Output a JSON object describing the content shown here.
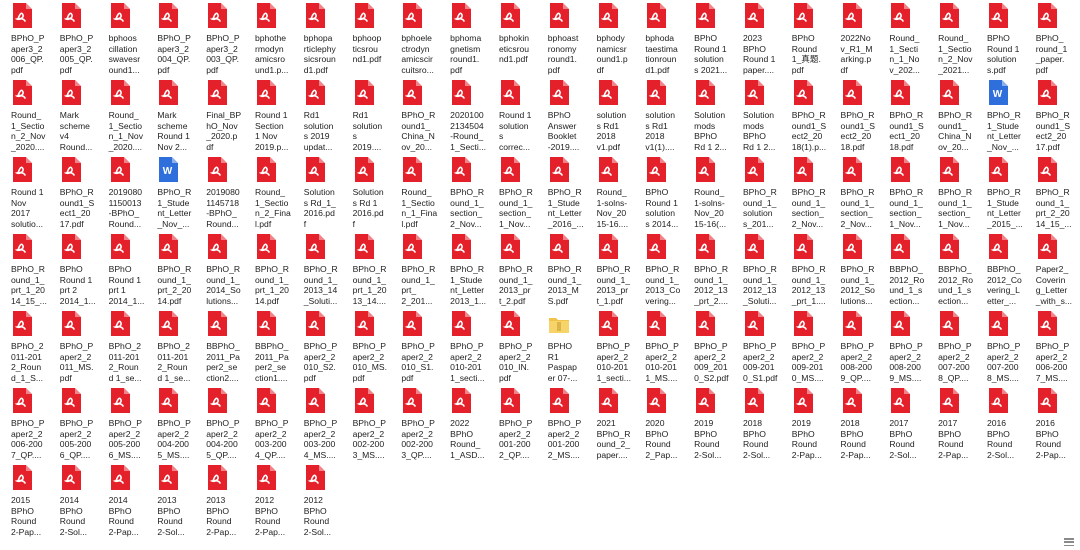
{
  "colors": {
    "pdf": "#e4202a",
    "word": "#2f6fdc",
    "folder": "#f2c34a"
  },
  "files": [
    {
      "name": "BPhO_P\naper3_2\n006_QP.\npdf",
      "type": "pdf"
    },
    {
      "name": "BPhO_P\naper3_2\n005_QP.\npdf",
      "type": "pdf"
    },
    {
      "name": "bphoos\ncillation\nswavesr\nound1...",
      "type": "pdf"
    },
    {
      "name": "BPhO_P\naper3_2\n004_QP.\npdf",
      "type": "pdf"
    },
    {
      "name": "BPhO_P\naper3_2\n003_QP.\npdf",
      "type": "pdf"
    },
    {
      "name": "bphothe\nrmodyn\namicsro\nund1.p...",
      "type": "pdf"
    },
    {
      "name": "bphopa\nrticlephy\nsicsroun\nd1.pdf",
      "type": "pdf"
    },
    {
      "name": "bphoop\nticsrou\nnd1.pdf",
      "type": "pdf"
    },
    {
      "name": "bphoele\nctrodyn\namicscir\ncuitsro...",
      "type": "pdf"
    },
    {
      "name": "bphoma\ngnetism\nround1.\npdf",
      "type": "pdf"
    },
    {
      "name": "bphokin\neticsrou\nnd1.pdf",
      "type": "pdf"
    },
    {
      "name": "bphoast\nronomy\nround1.\npdf",
      "type": "pdf"
    },
    {
      "name": "bphody\nnamicsr\nound1.p\ndf",
      "type": "pdf"
    },
    {
      "name": "bphoda\ntaestima\ntionroun\nd1.pdf",
      "type": "pdf"
    },
    {
      "name": "BPhO\nRound 1\nsolution\ns 2021...",
      "type": "pdf"
    },
    {
      "name": "2023\nBPhO\nRound 1\npaper....",
      "type": "pdf"
    },
    {
      "name": "BPhO\nRound\n1_真题.\npdf",
      "type": "pdf"
    },
    {
      "name": "2022No\nv_R1_M\narking.p\ndf",
      "type": "pdf"
    },
    {
      "name": "Round_\n1_Secti\nn_1_No\nv_202...",
      "type": "pdf"
    },
    {
      "name": "Round_\n1_Sectio\nn_2_Nov\n_2021...",
      "type": "pdf"
    },
    {
      "name": "BPhO\nRound 1\nsolution\ns.pdf",
      "type": "pdf"
    },
    {
      "name": "BPhO_\nround_1\n_paper.\npdf",
      "type": "pdf"
    },
    {
      "name": "Round_\n1_Sectio\nn_2_Nov\n_2020....",
      "type": "pdf"
    },
    {
      "name": "Mark\nscheme\nv4\nRound...",
      "type": "pdf"
    },
    {
      "name": "Round_\n1_Sectio\nn_1_Nov\n_2020....",
      "type": "pdf"
    },
    {
      "name": "Mark\nscheme\nRound 1\nNov 2...",
      "type": "pdf"
    },
    {
      "name": "Final_BP\nhO_Nov\n_2020.p\ndf",
      "type": "pdf"
    },
    {
      "name": "Round 1\nSection\n1 Nov\n2019.p...",
      "type": "pdf"
    },
    {
      "name": "Rd1\nsolution\ns 2019\nupdat...",
      "type": "pdf"
    },
    {
      "name": "Rd1\nsolution\ns\n2019....",
      "type": "pdf"
    },
    {
      "name": "BPhO_R\nound1_\nChina_N\nov_20...",
      "type": "pdf"
    },
    {
      "name": "2020100\n2134504\n-Round_\n1_Secti...",
      "type": "pdf"
    },
    {
      "name": "Round 1\nsolution\ns\ncorrec...",
      "type": "pdf"
    },
    {
      "name": "BPhO\nAnswer\nBooklet\n-2019....",
      "type": "pdf"
    },
    {
      "name": "solution\ns Rd1\n2018\nv1.pdf",
      "type": "pdf"
    },
    {
      "name": "solution\ns Rd1\n2018\nv1(1)....",
      "type": "pdf"
    },
    {
      "name": "Solution\nmods\nBPhO\nRd 1 2...",
      "type": "pdf"
    },
    {
      "name": "Solution\nmods\nBPhO\nRd 1 2...",
      "type": "pdf"
    },
    {
      "name": "BPhO_R\nound1_S\nect2_20\n18(1).p...",
      "type": "pdf"
    },
    {
      "name": "BPhO_R\nound1_S\nect2_20\n18.pdf",
      "type": "pdf"
    },
    {
      "name": "BPhO_R\nound1_S\nect1_20\n18.pdf",
      "type": "pdf"
    },
    {
      "name": "BPhO_R\nound1_\nChina_N\nov_20...",
      "type": "pdf"
    },
    {
      "name": "BPhO_R\n1_Stude\nnt_Letter\n_Nov_...",
      "type": "word"
    },
    {
      "name": "BPhO_R\nound1_S\nect2_20\n17.pdf",
      "type": "pdf"
    },
    {
      "name": "Round 1\nNov\n2017\nsolutio...",
      "type": "pdf"
    },
    {
      "name": "BPhO_R\nound1_S\nect1_20\n17.pdf",
      "type": "pdf"
    },
    {
      "name": "2019080\n1150013\n-BPhO_\nRound...",
      "type": "pdf"
    },
    {
      "name": "BPhO_R\n1_Stude\nnt_Letter\n_Nov_...",
      "type": "word"
    },
    {
      "name": "2019080\n1145718\n-BPhO_\nRound...",
      "type": "pdf"
    },
    {
      "name": "Round_\n1_Sectio\nn_2_Fina\nl.pdf",
      "type": "pdf"
    },
    {
      "name": "Solution\ns Rd_1_\n2016.pd\nf",
      "type": "pdf"
    },
    {
      "name": "Solution\ns Rd 1\n2016.pd\nf",
      "type": "pdf"
    },
    {
      "name": "Round_\n1_Sectio\nn_1_Fina\nl.pdf",
      "type": "pdf"
    },
    {
      "name": "BPhO_R\nound_1_\nsection_\n2_Nov...",
      "type": "pdf"
    },
    {
      "name": "BPhO_R\nound_1_\nsection_\n1_Nov...",
      "type": "pdf"
    },
    {
      "name": "BPhO_R\n1_Stude\nnt_Letter\n_2016_...",
      "type": "pdf"
    },
    {
      "name": "Round_\n1-solns-\nNov_20\n15-16....",
      "type": "pdf"
    },
    {
      "name": "BPhO\nRound 1\nsolution\ns 2014...",
      "type": "pdf"
    },
    {
      "name": "Round_\n1-solns-\nNov_20\n15-16(...",
      "type": "pdf"
    },
    {
      "name": "BPhO_R\nound_1_\nsolution\ns_201...",
      "type": "pdf"
    },
    {
      "name": "BPhO_R\nound_1_\nsection_\n2_Nov...",
      "type": "pdf"
    },
    {
      "name": "BPhO_R\nound_1_\nsection_\n2_Nov...",
      "type": "pdf"
    },
    {
      "name": "BPhO_R\nound_1_\nsection_\n1_Nov...",
      "type": "pdf"
    },
    {
      "name": "BPhO_R\nound_1_\nsection_\n1_Nov...",
      "type": "pdf"
    },
    {
      "name": "BPhO_R\n1_Stude\nnt_Letter\n_2015_...",
      "type": "pdf"
    },
    {
      "name": "BPhO_R\nound_1_\nprt_2_20\n14_15_...",
      "type": "pdf"
    },
    {
      "name": "BPhO_R\nound_1_\nprt_1_20\n14_15_...",
      "type": "pdf"
    },
    {
      "name": "BPhO\nRound 1\nprt 2\n2014_1...",
      "type": "pdf"
    },
    {
      "name": "BPhO\nRound 1\nprt 1\n2014_1...",
      "type": "pdf"
    },
    {
      "name": "BPhO_R\nound_1_\nprt_2_20\n14.pdf",
      "type": "pdf"
    },
    {
      "name": "BPhO_R\nound_1_\n2014_So\nlutions...",
      "type": "pdf"
    },
    {
      "name": "BPhO_R\nound_1_\nprt_1_20\n14.pdf",
      "type": "pdf"
    },
    {
      "name": "BPhO_R\nound_1_\n2013_14\n_Soluti...",
      "type": "pdf"
    },
    {
      "name": "BPhO_R\nound_1_\nprt_1_20\n13_14....",
      "type": "pdf"
    },
    {
      "name": "BPhO_R\nound_1_\nprt_\n2_201...",
      "type": "pdf"
    },
    {
      "name": "BPhO_R\n1_Stude\nnt_Letter\n2013_1...",
      "type": "pdf"
    },
    {
      "name": "BPhO_R\nound_1_\n2013_pr\nt_2.pdf",
      "type": "pdf"
    },
    {
      "name": "BPhO_R\nound_1_\n2013_M\nS.pdf",
      "type": "pdf"
    },
    {
      "name": "BPhO_R\nound_1_\n2013_pr\nt_1.pdf",
      "type": "pdf"
    },
    {
      "name": "BPhO_R\nound_1_\n2013_Co\nvering...",
      "type": "pdf"
    },
    {
      "name": "BPhO_R\nound_1_\n2012_13\n_prt_2....",
      "type": "pdf"
    },
    {
      "name": "BPhO_R\nound_1_\n2012_13\n_Soluti...",
      "type": "pdf"
    },
    {
      "name": "BPhO_R\nound_1_\n2012_13\n_prt_1....",
      "type": "pdf"
    },
    {
      "name": "BPhO_R\nound_1_\n2012_So\nlutions...",
      "type": "pdf"
    },
    {
      "name": "BBPhO_\n2012_Ro\nund_1_s\nection...",
      "type": "pdf"
    },
    {
      "name": "BBPhO_\n2012_Ro\nund_1_s\nection...",
      "type": "pdf"
    },
    {
      "name": "BBPhO_\n2012_Co\nvering_L\netter_...",
      "type": "pdf"
    },
    {
      "name": "Paper2_\nCoverin\ng_Letter\n_with_s...",
      "type": "pdf"
    },
    {
      "name": "BPhO_2\n011-201\n2_Roun\nd_1_S...",
      "type": "pdf"
    },
    {
      "name": "BPhO_P\naper2_2\n011_MS.\npdf",
      "type": "pdf"
    },
    {
      "name": "BPhO_2\n011-201\n2_Roun\nd 1_se...",
      "type": "pdf"
    },
    {
      "name": "BPhO_2\n011-201\n2_Roun\nd 1_se...",
      "type": "pdf"
    },
    {
      "name": "BBPhO_\n2011_Pa\nper2_se\nction2....",
      "type": "pdf"
    },
    {
      "name": "BBPhO_\n2011_Pa\nper2_se\nction1....",
      "type": "pdf"
    },
    {
      "name": "BPhO_P\naper2_2\n010_S2.\npdf",
      "type": "pdf"
    },
    {
      "name": "BPhO_P\naper2_2\n010_MS.\npdf",
      "type": "pdf"
    },
    {
      "name": "BPhO_P\naper2_2\n010_S1.\npdf",
      "type": "pdf"
    },
    {
      "name": "BPhO_P\naper2_2\n010-201\n1_secti...",
      "type": "pdf"
    },
    {
      "name": "BPhO_P\naper2_2\n010_IN.\npdf",
      "type": "pdf"
    },
    {
      "name": "BPHO\nR1\nPaspap\ner 07-...",
      "type": "folder"
    },
    {
      "name": "BPhO_P\naper2_2\n010-201\n1_secti...",
      "type": "pdf"
    },
    {
      "name": "BPhO_P\naper2_2\n010-201\n1_MS....",
      "type": "pdf"
    },
    {
      "name": "BPhO_P\naper2_2\n009_201\n0_S2.pdf",
      "type": "pdf"
    },
    {
      "name": "BPhO_P\naper2_2\n009-201\n0_S1.pdf",
      "type": "pdf"
    },
    {
      "name": "BPhO_P\naper2_2\n009-201\n0_MS....",
      "type": "pdf"
    },
    {
      "name": "BPhO_P\naper2_2\n008-200\n9_QP....",
      "type": "pdf"
    },
    {
      "name": "BPhO_P\naper2_2\n008-200\n9_MS....",
      "type": "pdf"
    },
    {
      "name": "BPhO_P\naper2_2\n007-200\n8_QP....",
      "type": "pdf"
    },
    {
      "name": "BPhO_P\naper2_2\n007-200\n8_MS....",
      "type": "pdf"
    },
    {
      "name": "BPhO_P\naper2_2\n006-200\n7_MS....",
      "type": "pdf"
    },
    {
      "name": "BPhO_P\naper2_2\n006-200\n7_QP....",
      "type": "pdf"
    },
    {
      "name": "BPhO_P\naper2_2\n005-200\n6_QP....",
      "type": "pdf"
    },
    {
      "name": "BPhO_P\naper2_2\n005-200\n6_MS....",
      "type": "pdf"
    },
    {
      "name": "BPhO_P\naper2_2\n004-200\n5_MS....",
      "type": "pdf"
    },
    {
      "name": "BPhO_P\naper2_2\n004-200\n5_QP....",
      "type": "pdf"
    },
    {
      "name": "BPhO_P\naper2_2\n003-200\n4_QP....",
      "type": "pdf"
    },
    {
      "name": "BPhO_P\naper2_2\n003-200\n4_MS....",
      "type": "pdf"
    },
    {
      "name": "BPhO_P\naper2_2\n002-200\n3_MS....",
      "type": "pdf"
    },
    {
      "name": "BPhO_P\naper2_2\n002-200\n3_QP....",
      "type": "pdf"
    },
    {
      "name": "2022\nBPhO\nRound_\n1_ASD...",
      "type": "pdf"
    },
    {
      "name": "BPhO_P\naper2_2\n001-200\n2_QP....",
      "type": "pdf"
    },
    {
      "name": "BPhO_P\naper2_2\n001-200\n2_MS....",
      "type": "pdf"
    },
    {
      "name": "2021\nBPhO_R\nound_2_\npaper....",
      "type": "pdf"
    },
    {
      "name": "2020\nBPhO\nRound\n2_Pap...",
      "type": "pdf"
    },
    {
      "name": "2019\nBPhO\nRound\n2-Sol...",
      "type": "pdf"
    },
    {
      "name": "2018\nBPhO\nRound\n2-Sol...",
      "type": "pdf"
    },
    {
      "name": "2019\nBPhO\nRound\n2-Pap...",
      "type": "pdf"
    },
    {
      "name": "2018\nBPhO\nRound\n2-Pap...",
      "type": "pdf"
    },
    {
      "name": "2017\nBPhO\nRound\n2-Sol...",
      "type": "pdf"
    },
    {
      "name": "2017\nBPhO\nRound\n2-Pap...",
      "type": "pdf"
    },
    {
      "name": "2016\nBPhO\nRound\n2-Sol...",
      "type": "pdf"
    },
    {
      "name": "2016\nBPhO\nRound\n2-Pap...",
      "type": "pdf"
    },
    {
      "name": "2015\nBPhO\nRound\n2-Pap...",
      "type": "pdf"
    },
    {
      "name": "2014\nBPhO\nRound\n2-Sol...",
      "type": "pdf"
    },
    {
      "name": "2014\nBPhO\nRound\n2-Pap...",
      "type": "pdf"
    },
    {
      "name": "2013\nBPhO\nRound\n2-Sol...",
      "type": "pdf"
    },
    {
      "name": "2013\nBPhO\nRound\n2-Pap...",
      "type": "pdf"
    },
    {
      "name": "2012\nBPhO\nRound\n2-Pap...",
      "type": "pdf"
    },
    {
      "name": "2012\nBPhO\nRound\n2-Sol...",
      "type": "pdf"
    }
  ]
}
